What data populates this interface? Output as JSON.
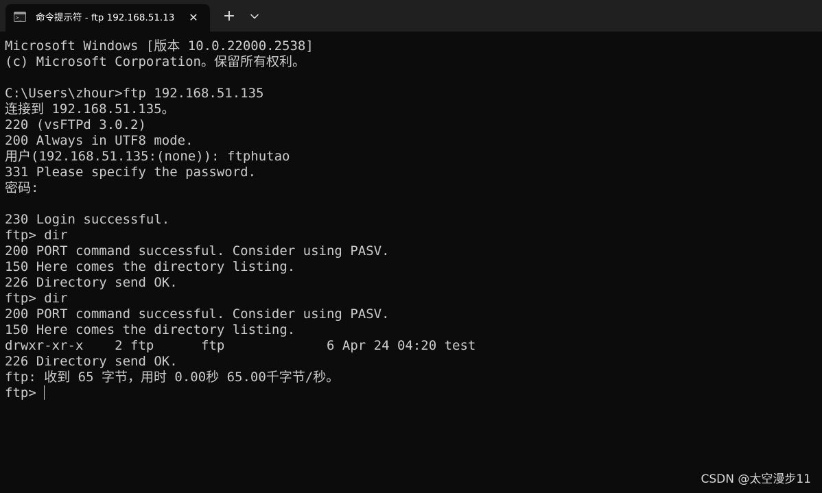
{
  "tab": {
    "icon": "terminal-icon",
    "icon_glyph": ">_",
    "title": "命令提示符 - ftp  192.168.51.13",
    "close_glyph": "✕"
  },
  "tabbar": {
    "new_tab_glyph": "+",
    "dropdown_icon": "chevron-down-icon"
  },
  "terminal": {
    "lines": [
      "Microsoft Windows [版本 10.0.22000.2538]",
      "(c) Microsoft Corporation。保留所有权利。",
      "",
      "C:\\Users\\zhour>ftp 192.168.51.135",
      "连接到 192.168.51.135。",
      "220 (vsFTPd 3.0.2)",
      "200 Always in UTF8 mode.",
      "用户(192.168.51.135:(none)): ftphutao",
      "331 Please specify the password.",
      "密码:",
      "",
      "230 Login successful.",
      "ftp> dir",
      "200 PORT command successful. Consider using PASV.",
      "150 Here comes the directory listing.",
      "226 Directory send OK.",
      "ftp> dir",
      "200 PORT command successful. Consider using PASV.",
      "150 Here comes the directory listing.",
      "drwxr-xr-x    2 ftp      ftp             6 Apr 24 04:20 test",
      "226 Directory send OK.",
      "ftp: 收到 65 字节，用时 0.00秒 65.00千字节/秒。"
    ],
    "prompt": "ftp> "
  },
  "watermark": "CSDN @太空漫步11",
  "colors": {
    "background": "#0c0c0c",
    "tabbar": "#202020",
    "text": "#cccccc"
  }
}
